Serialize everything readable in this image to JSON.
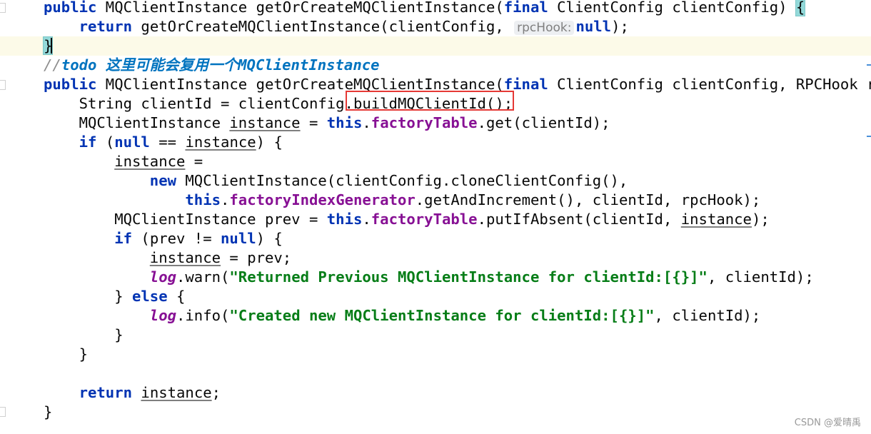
{
  "lines": [
    [
      {
        "t": "public",
        "c": "kw"
      },
      {
        "t": " MQClientInstance getOrCreateMQClientInstance("
      },
      {
        "t": "final",
        "c": "kw"
      },
      {
        "t": " ClientConfig clientConfig) "
      },
      {
        "t": "{",
        "c": "brace-hl"
      }
    ],
    [
      {
        "t": "    "
      },
      {
        "t": "return",
        "c": "kw"
      },
      {
        "t": " getOrCreateMQClientInstance(clientConfig, "
      },
      {
        "t": "rpcHook:",
        "c": "hint"
      },
      {
        "t": "null",
        "c": "kw"
      },
      {
        "t": ");"
      }
    ],
    [
      {
        "t": "}",
        "c": "brace-hl"
      }
    ],
    [
      {
        "t": "//",
        "c": "cmt"
      },
      {
        "t": "todo 这里可能会复用一个MQClientInstance",
        "c": "todo"
      }
    ],
    [
      {
        "t": "public",
        "c": "kw"
      },
      {
        "t": " MQClientInstance getOrCreateMQClientInstance("
      },
      {
        "t": "final",
        "c": "kw"
      },
      {
        "t": " ClientConfig clientConfig, RPCHook r"
      }
    ],
    [
      {
        "t": "    String clientId = clientConfig.buildMQClientId();"
      }
    ],
    [
      {
        "t": "    MQClientInstance "
      },
      {
        "t": "instance",
        "c": "u"
      },
      {
        "t": " = "
      },
      {
        "t": "this",
        "c": "kw"
      },
      {
        "t": "."
      },
      {
        "t": "factoryTable",
        "c": "fld"
      },
      {
        "t": ".get(clientId);"
      }
    ],
    [
      {
        "t": "    "
      },
      {
        "t": "if",
        "c": "kw"
      },
      {
        "t": " ("
      },
      {
        "t": "null",
        "c": "kw"
      },
      {
        "t": " == "
      },
      {
        "t": "instance",
        "c": "u"
      },
      {
        "t": ") {"
      }
    ],
    [
      {
        "t": "        "
      },
      {
        "t": "instance",
        "c": "u"
      },
      {
        "t": " ="
      }
    ],
    [
      {
        "t": "            "
      },
      {
        "t": "new",
        "c": "kw"
      },
      {
        "t": " MQClientInstance(clientConfig.cloneClientConfig(),"
      }
    ],
    [
      {
        "t": "                "
      },
      {
        "t": "this",
        "c": "kw"
      },
      {
        "t": "."
      },
      {
        "t": "factoryIndexGenerator",
        "c": "fld"
      },
      {
        "t": ".getAndIncrement(), clientId, rpcHook);"
      }
    ],
    [
      {
        "t": "        MQClientInstance prev = "
      },
      {
        "t": "this",
        "c": "kw"
      },
      {
        "t": "."
      },
      {
        "t": "factoryTable",
        "c": "fld"
      },
      {
        "t": ".putIfAbsent(clientId, "
      },
      {
        "t": "instance",
        "c": "u"
      },
      {
        "t": ");"
      }
    ],
    [
      {
        "t": "        "
      },
      {
        "t": "if",
        "c": "kw"
      },
      {
        "t": " (prev != "
      },
      {
        "t": "null",
        "c": "kw"
      },
      {
        "t": ") {"
      }
    ],
    [
      {
        "t": "            "
      },
      {
        "t": "instance",
        "c": "u"
      },
      {
        "t": " = prev;"
      }
    ],
    [
      {
        "t": "            "
      },
      {
        "t": "log",
        "c": "st"
      },
      {
        "t": ".warn("
      },
      {
        "t": "\"Returned Previous MQClientInstance for clientId:[{}]\"",
        "c": "str"
      },
      {
        "t": ", clientId);"
      }
    ],
    [
      {
        "t": "        } "
      },
      {
        "t": "else",
        "c": "kw"
      },
      {
        "t": " {"
      }
    ],
    [
      {
        "t": "            "
      },
      {
        "t": "log",
        "c": "st"
      },
      {
        "t": ".info("
      },
      {
        "t": "\"Created new MQClientInstance for clientId:[{}]\"",
        "c": "str"
      },
      {
        "t": ", clientId);"
      }
    ],
    [
      {
        "t": "        }"
      }
    ],
    [
      {
        "t": "    }"
      }
    ],
    [],
    [
      {
        "t": "    "
      },
      {
        "t": "return",
        "c": "kw"
      },
      {
        "t": " "
      },
      {
        "t": "instance",
        "c": "u"
      },
      {
        "t": ";"
      }
    ],
    [
      {
        "t": "}"
      }
    ]
  ],
  "highlighted_code": ".buildMQClientId();",
  "watermark": "CSDN @爱晴禹"
}
